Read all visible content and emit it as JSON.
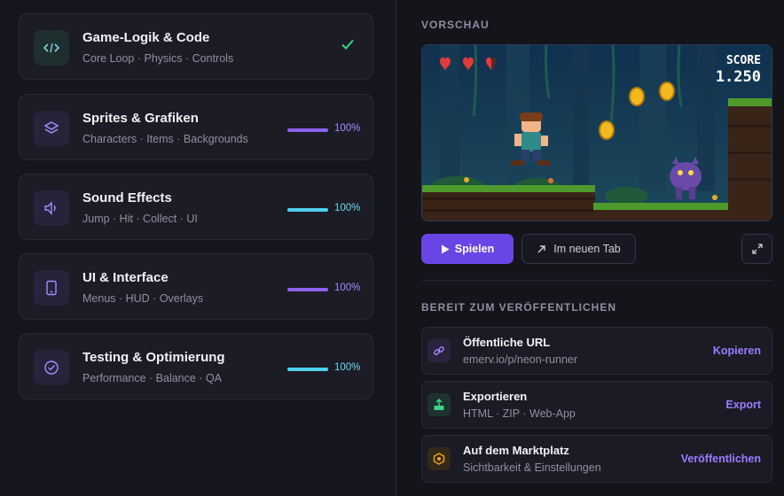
{
  "tasks": [
    {
      "title": "Game-Logik & Code",
      "sub": "Core Loop · Physics · Controls",
      "status": "done"
    },
    {
      "title": "Sprites & Grafiken",
      "sub": "Characters · Items · Backgrounds",
      "progress": "100%",
      "color": "#8b63f0"
    },
    {
      "title": "Sound Effects",
      "sub": "Jump · Hit · Collect · UI",
      "progress": "100%",
      "color": "#4fd0ee"
    },
    {
      "title": "UI & Interface",
      "sub": "Menus · HUD · Overlays",
      "progress": "100%",
      "color": "#8b63f0"
    },
    {
      "title": "Testing & Optimierung",
      "sub": "Performance · Balance · QA",
      "progress": "100%",
      "color": "#4fd0ee"
    }
  ],
  "preview": {
    "section_title": "VORSCHAU",
    "score_label": "SCORE",
    "score_value": "1.250",
    "lives_full": 2,
    "lives_total": 3
  },
  "buttons": {
    "play": "Spielen",
    "new_tab": "Im neuen Tab"
  },
  "publish": {
    "section_title": "BEREIT ZUM VERÖFFENTLICHEN",
    "items": [
      {
        "title": "Öffentliche URL",
        "sub": "emerv.io/p/neon-runner",
        "action": "Kopieren",
        "icon": "link-icon"
      },
      {
        "title": "Exportieren",
        "sub": "HTML · ZIP · Web-App",
        "action": "Export",
        "icon": "export-icon"
      },
      {
        "title": "Auf dem Marktplatz",
        "sub": "Sichtbarkeit & Einstellungen",
        "action": "Veröffentlichen",
        "icon": "marketplace-badge-icon"
      }
    ]
  }
}
